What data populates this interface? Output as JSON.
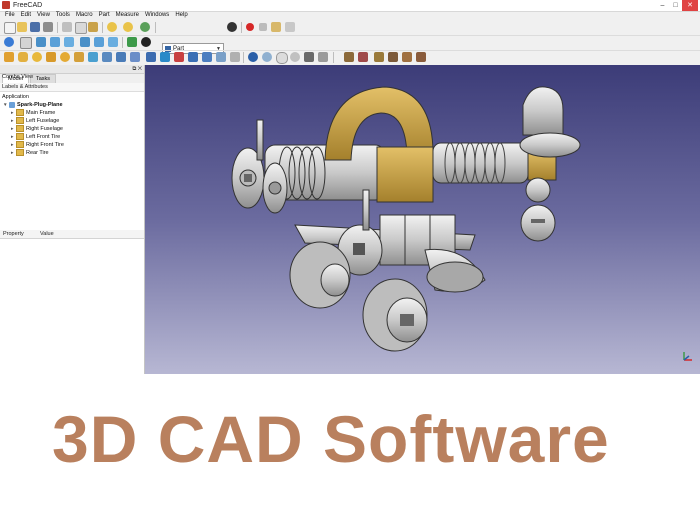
{
  "window": {
    "title": "FreeCAD"
  },
  "window_controls": {
    "minimize": "–",
    "maximize": "□",
    "close": "✕"
  },
  "menu": [
    "File",
    "Edit",
    "View",
    "Tools",
    "Macro",
    "Part",
    "Measure",
    "Windows",
    "Help"
  ],
  "toolbar": {
    "workbench": "Part"
  },
  "combo_view": {
    "title": "Combo View",
    "controls": "⧉ ✕",
    "tabs": [
      "Model",
      "Tasks"
    ],
    "labels_header": "Labels & Attributes",
    "application_label": "Application",
    "document": "Spark-Plug-Plane",
    "tree_items": [
      "Main Frame",
      "Left Fuselage",
      "Right Fuselage",
      "Left Front Tire",
      "Right Front Tire",
      "Rear Tire"
    ],
    "property_columns": [
      "Property",
      "Value"
    ]
  },
  "caption": "3D CAD Software",
  "colors": {
    "caption": "#b9805e",
    "viewport_top": "#3c3c78",
    "viewport_bottom": "#b7b7d3",
    "accent_gold": "#c8a040"
  },
  "icons": [
    "new-file-icon",
    "open-icon",
    "save-icon",
    "print-icon",
    "cut-icon",
    "copy-icon",
    "paste-icon",
    "undo-icon",
    "redo-icon",
    "refresh-icon",
    "whats-this-icon",
    "macro-record-icon",
    "macro-stop-icon",
    "macro-edit-icon",
    "macro-play-icon",
    "fit-all-icon",
    "view-isometric-icon",
    "view-front-icon",
    "view-top-icon",
    "view-right-icon",
    "view-rear-icon",
    "view-bottom-icon",
    "view-left-icon",
    "measure-icon",
    "draw-style-icon",
    "box-icon",
    "cylinder-icon",
    "sphere-icon",
    "cone-icon",
    "torus-icon",
    "boolean-icon",
    "cut-shape-icon",
    "fuse-icon",
    "common-icon",
    "extrude-icon",
    "revolve-icon",
    "mirror-icon",
    "fillet-icon",
    "chamfer-icon",
    "axis-cross-icon"
  ]
}
